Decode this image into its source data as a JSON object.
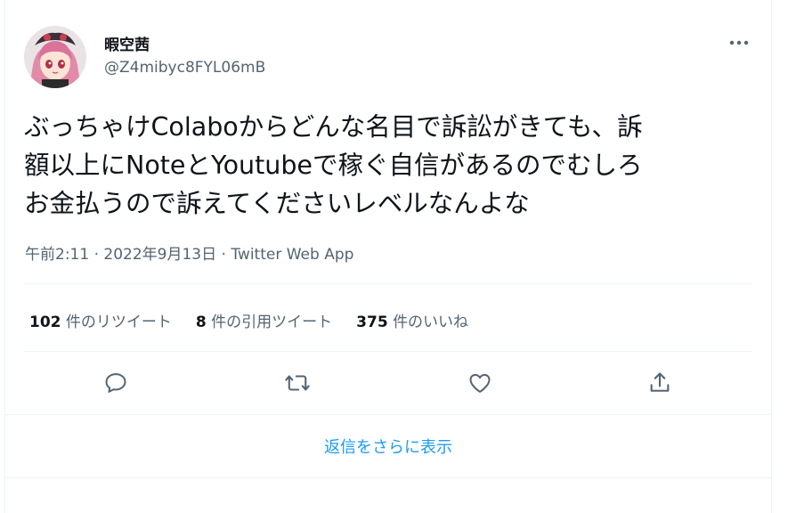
{
  "user": {
    "display_name": "暇空茜",
    "handle": "@Z4mibyc8FYL06mB"
  },
  "tweet": {
    "text": "ぶっちゃけColaboからどんな名目で訴訟がきても、訴\n額以上にNoteとYoutubeで稼ぐ自信があるのでむしろ\nお金払うので訴えてくださいレベルなんよな",
    "time": "午前2:11",
    "separator": "·",
    "date": "2022年9月13日",
    "source": "Twitter Web App"
  },
  "stats": {
    "retweets_count": "102",
    "retweets_label": "件のリツイート",
    "quotes_count": "8",
    "quotes_label": "件の引用ツイート",
    "likes_count": "375",
    "likes_label": "件のいいね"
  },
  "actions": {
    "icons": [
      "reply-icon",
      "retweet-icon",
      "like-icon",
      "share-icon"
    ]
  },
  "replies": {
    "show_more_label": "返信をさらに表示"
  },
  "colors": {
    "text": "#0f1419",
    "secondary": "#536471",
    "accent": "#1d9bf0",
    "divider": "#eff3f4"
  }
}
